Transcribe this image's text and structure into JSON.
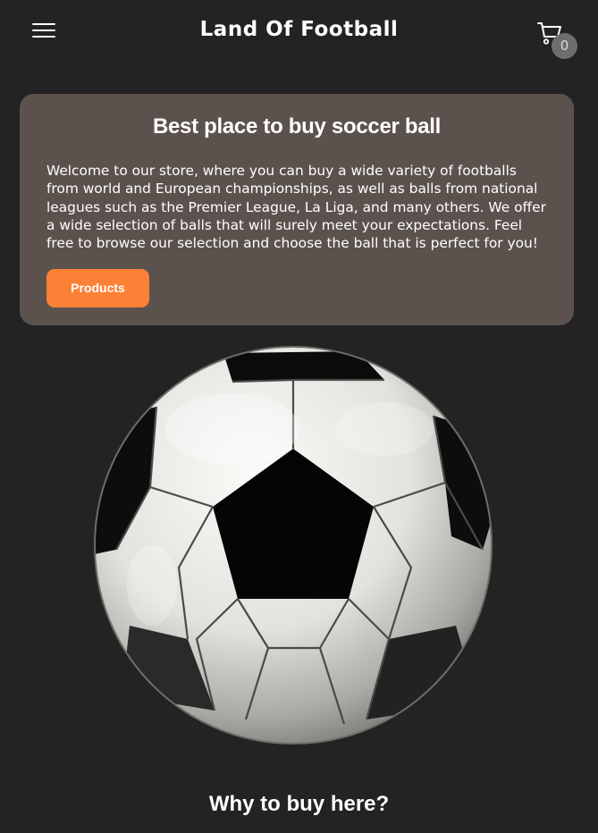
{
  "header": {
    "title": "Land Of Football",
    "menu_icon": "hamburger-menu-icon",
    "cart_icon": "shopping-cart-icon",
    "cart_count": "0"
  },
  "hero": {
    "title": "Best place to buy soccer ball",
    "text": "Welcome to our store, where you can buy a wide variety of footballs from world and European championships, as well as balls from national leagues such as the Premier League, La Liga, and many others. We offer a wide selection of balls that will surely meet your expectations. Feel free to browse our selection and choose the ball that is perfect for you!",
    "button_label": "Products"
  },
  "section": {
    "title": "Why to buy here?"
  },
  "colors": {
    "background": "#232323",
    "card": "#5c524d",
    "accent": "#fb8137",
    "badge": "#6e6e6e"
  }
}
